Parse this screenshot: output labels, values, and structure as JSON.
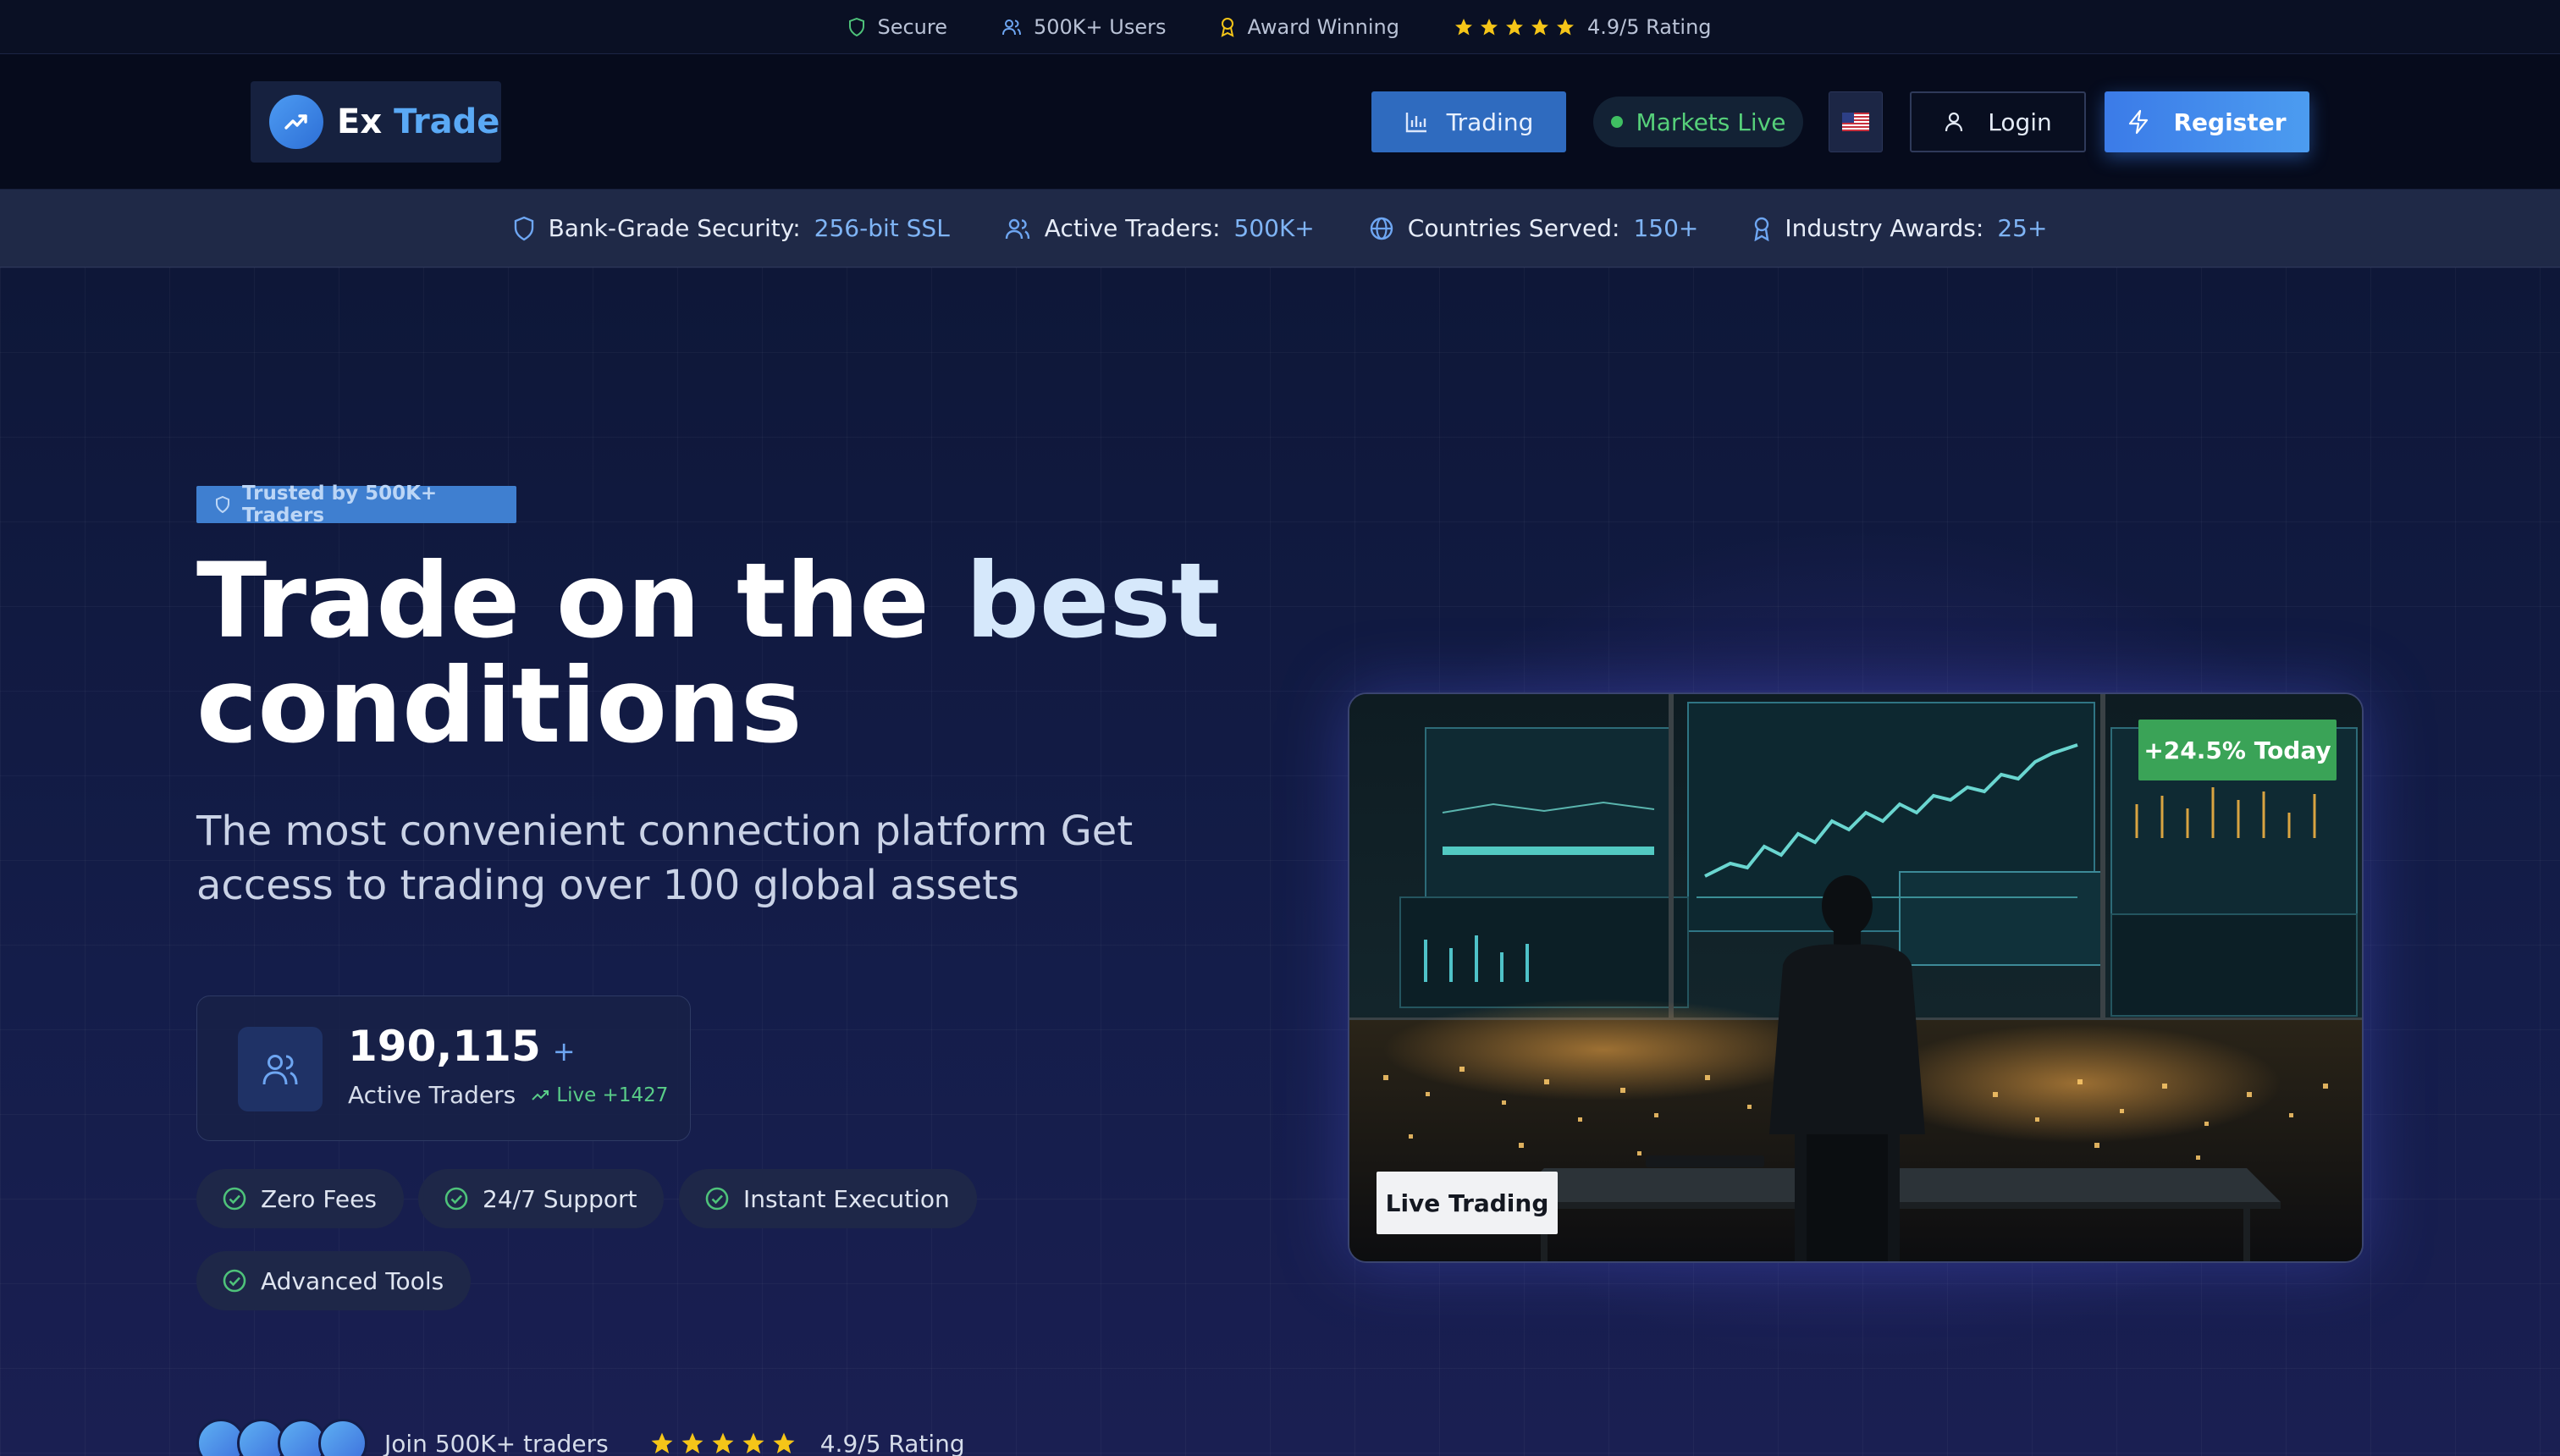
{
  "colors": {
    "accent": "#3b7be8",
    "brand_light": "#5aa9f5",
    "live_green": "#3fbf62",
    "gain_green": "#3aa357",
    "star": "#f5c518",
    "background": "#0b1230"
  },
  "topbar": {
    "items": [
      {
        "icon": "shield-icon",
        "label": "Secure"
      },
      {
        "icon": "users-icon",
        "label": "500K+ Users"
      },
      {
        "icon": "award-icon",
        "label": "Award Winning"
      }
    ],
    "rating": {
      "stars": 5,
      "label": "4.9/5 Rating"
    }
  },
  "header": {
    "logo": {
      "part1": "Ex",
      "part2": "Trade",
      "icon": "trending-up-icon"
    },
    "trading_label": "Trading",
    "markets_live_label": "Markets Live",
    "language_flag": "us-flag-icon",
    "login_label": "Login",
    "register_label": "Register"
  },
  "stats": [
    {
      "icon": "shield-icon",
      "label": "Bank-Grade Security:",
      "value": "256-bit SSL"
    },
    {
      "icon": "users-icon",
      "label": "Active Traders:",
      "value": "500K+"
    },
    {
      "icon": "globe-icon",
      "label": "Countries Served:",
      "value": "150+"
    },
    {
      "icon": "award-icon",
      "label": "Industry Awards:",
      "value": "25+"
    }
  ],
  "hero": {
    "trust_badge": "Trusted by 500K+ Traders",
    "headline_part1": "Trade on the",
    "headline_highlight": "best",
    "headline_part2": "conditions",
    "subtitle": "The most convenient connection platform Get access to trading over 100 global assets",
    "traders_card": {
      "count": "190,115",
      "plus": "+",
      "label": "Active Traders",
      "live_increment": "Live +1427"
    },
    "features": [
      "Zero Fees",
      "24/7 Support",
      "Instant Execution",
      "Advanced Tools"
    ],
    "social_proof": {
      "join_text": "Join 500K+ traders",
      "rating_label": "4.9/5 Rating",
      "stars": 5
    },
    "image": {
      "gain_badge": "+24.5% Today",
      "caption": "Live Trading"
    }
  }
}
